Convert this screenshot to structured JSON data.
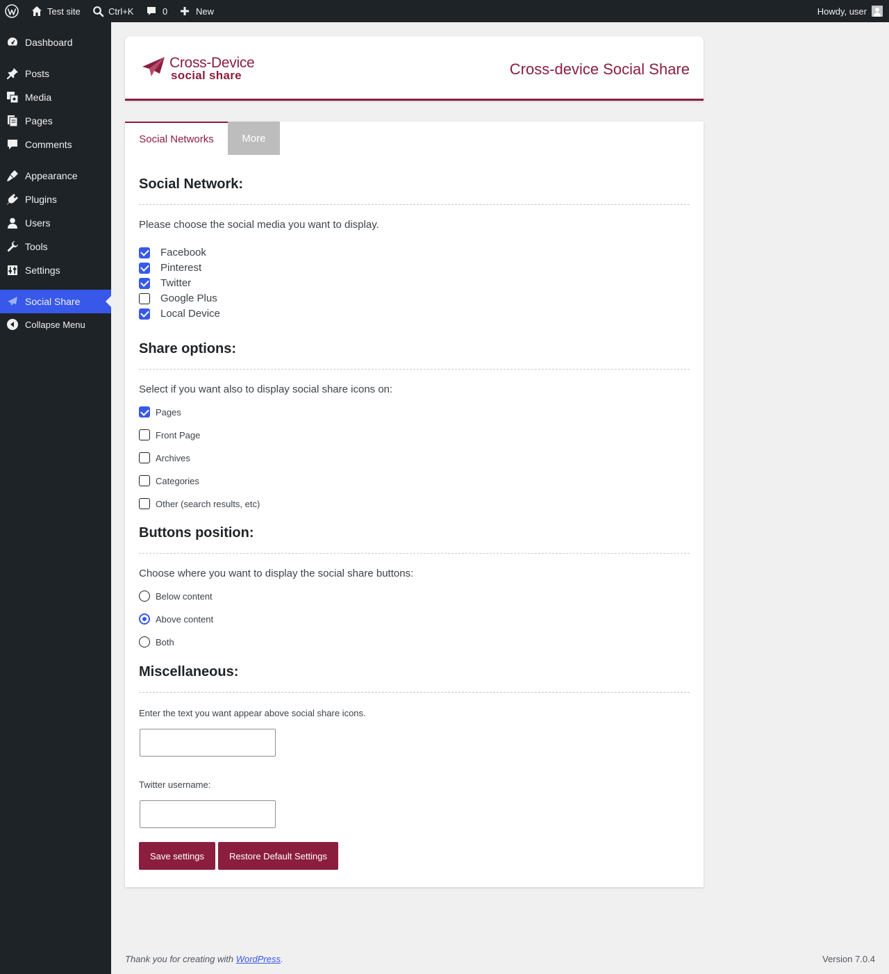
{
  "adminbar": {
    "site_name": "Test site",
    "search_shortcut": "Ctrl+K",
    "comments_count": "0",
    "new_label": "New",
    "greeting": "Howdy, user"
  },
  "sidebar": {
    "items": [
      {
        "label": "Dashboard",
        "icon": "dashboard-icon"
      },
      {
        "label": "Posts",
        "icon": "pin-icon"
      },
      {
        "label": "Media",
        "icon": "media-icon"
      },
      {
        "label": "Pages",
        "icon": "pages-icon"
      },
      {
        "label": "Comments",
        "icon": "comment-icon"
      },
      {
        "label": "Appearance",
        "icon": "paintbrush-icon"
      },
      {
        "label": "Plugins",
        "icon": "plugin-icon"
      },
      {
        "label": "Users",
        "icon": "user-icon"
      },
      {
        "label": "Tools",
        "icon": "wrench-icon"
      },
      {
        "label": "Settings",
        "icon": "sliders-icon"
      },
      {
        "label": "Social Share",
        "icon": "paper-plane-icon",
        "current": true
      }
    ],
    "collapse_label": "Collapse Menu"
  },
  "header": {
    "logo_line1": "Cross-Device",
    "logo_line2": "social share",
    "title": "Cross-device Social Share"
  },
  "tabs": [
    "Social Networks",
    "More"
  ],
  "networks": {
    "title": "Social Network:",
    "description": "Please choose the social media you want to display.",
    "items": [
      {
        "label": "Facebook",
        "checked": true
      },
      {
        "label": "Pinterest",
        "checked": true
      },
      {
        "label": "Twitter",
        "checked": true
      },
      {
        "label": "Google Plus",
        "checked": false
      },
      {
        "label": "Local Device",
        "checked": true
      }
    ]
  },
  "share_options": {
    "title": "Share options:",
    "description": "Select if you want also to display social share icons on:",
    "items": [
      {
        "label": "Pages",
        "checked": true
      },
      {
        "label": "Front Page",
        "checked": false
      },
      {
        "label": "Archives",
        "checked": false
      },
      {
        "label": "Categories",
        "checked": false
      },
      {
        "label": "Other (search results, etc)",
        "checked": false
      }
    ]
  },
  "position": {
    "title": "Buttons position:",
    "description": "Choose where you want to display the social share buttons:",
    "items": [
      {
        "label": "Below content",
        "selected": false
      },
      {
        "label": "Above content",
        "selected": true
      },
      {
        "label": "Both",
        "selected": false
      }
    ]
  },
  "misc": {
    "title": "Miscellaneous:",
    "text_label": "Enter the text you want appear above social share icons.",
    "text_value": "",
    "twitter_label": "Twitter username:",
    "twitter_value": ""
  },
  "buttons": {
    "save": "Save settings",
    "restore": "Restore Default Settings"
  },
  "footer": {
    "thanks_prefix": "Thank you for creating with ",
    "thanks_link": "WordPress",
    "thanks_suffix": ".",
    "version": "Version 7.0.4"
  },
  "colors": {
    "brand": "#8b1e3f",
    "accent": "#3858e9",
    "admin_dark": "#1d2327"
  }
}
